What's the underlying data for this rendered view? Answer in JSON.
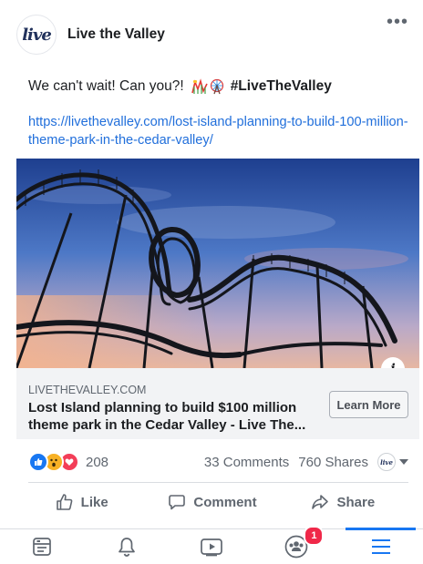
{
  "post": {
    "page_name": "Live the Valley",
    "avatar_logo": "live",
    "text": "We can't wait! Can you?!",
    "emojis": [
      "roller-coaster-emoji",
      "ferris-wheel-emoji"
    ],
    "hashtag": "#LiveTheValley",
    "link_text": "https://livethevalley.com/lost-island-planning-to-build-100-million-theme-park-in-the-cedar-valley/"
  },
  "link_preview": {
    "domain": "LIVETHEVALLEY.COM",
    "title": "Lost Island planning to build $100 million theme park in the Cedar Valley - Live The...",
    "cta": "Learn More",
    "info_icon": "i"
  },
  "stats": {
    "reaction_icons": [
      "like-reaction-icon",
      "wow-reaction-icon",
      "love-reaction-icon"
    ],
    "reaction_count": "208",
    "comments": "33 Comments",
    "shares": "760 Shares"
  },
  "actions": {
    "like": "Like",
    "comment": "Comment",
    "share": "Share"
  },
  "nav": {
    "items": [
      "news-feed-icon",
      "notifications-bell-icon",
      "watch-video-icon",
      "groups-icon",
      "menu-icon"
    ],
    "groups_badge": "1",
    "active": "menu-icon"
  },
  "colors": {
    "link": "#216fdb",
    "accent": "#1877f2",
    "badge": "#f02849"
  }
}
